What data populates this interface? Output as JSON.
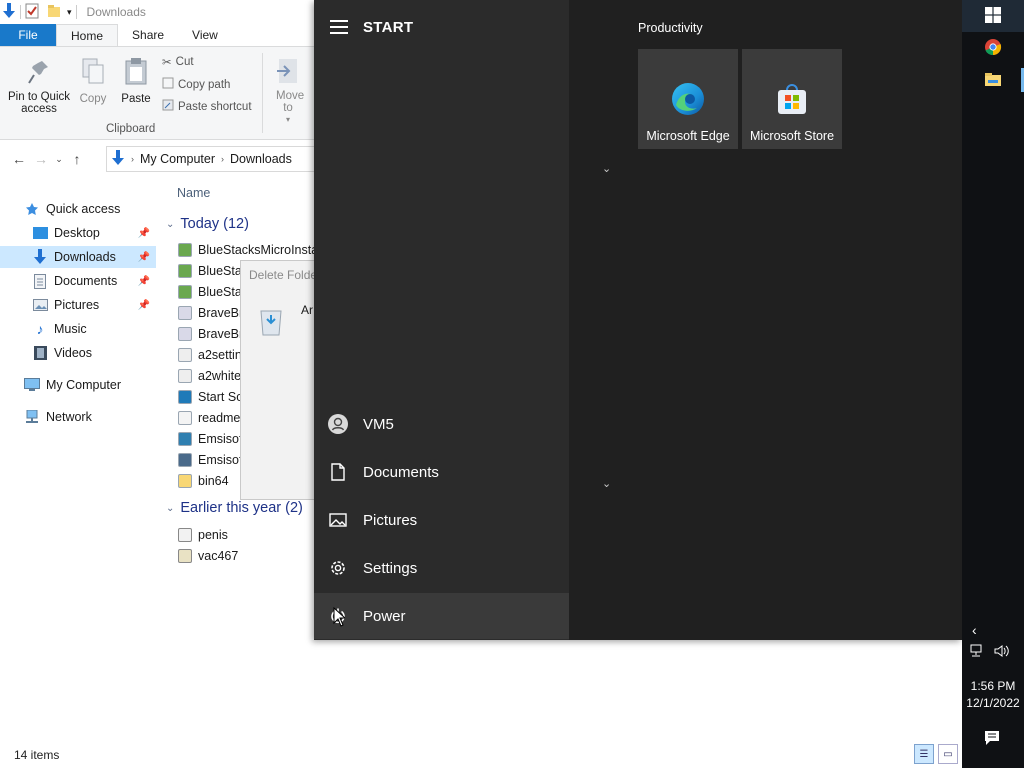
{
  "explorer": {
    "window_title": "Downloads",
    "ribbon_tabs": [
      "File",
      "Home",
      "Share",
      "View"
    ],
    "ribbon": {
      "pin_label": "Pin to Quick access",
      "copy_label": "Copy",
      "paste_label": "Paste",
      "cut_label": "Cut",
      "copy_path_label": "Copy path",
      "paste_shortcut_label": "Paste shortcut",
      "move_to_label": "Move to",
      "group_clipboard": "Clipboard"
    },
    "breadcrumb": [
      "My Computer",
      "Downloads"
    ],
    "nav": {
      "quick_access": "Quick access",
      "desktop": "Desktop",
      "downloads": "Downloads",
      "documents": "Documents",
      "pictures": "Pictures",
      "music": "Music",
      "videos": "Videos",
      "my_computer": "My Computer",
      "network": "Network"
    },
    "column_name": "Name",
    "group_today": "Today (12)",
    "group_earlier": "Earlier this year (2)",
    "files_today": [
      "BlueStacksMicroInstal",
      "BlueStac",
      "BlueStac",
      "BraveBro",
      "BraveBro",
      "a2setting",
      "a2whitel",
      "Start Sca",
      "readme",
      "Emsisoft",
      "Emsisoft",
      "bin64"
    ],
    "files_earlier": [
      "penis",
      "vac467"
    ],
    "context_header": "Delete Folde",
    "context_item": "Ar",
    "status": "14 items"
  },
  "start_menu": {
    "title": "START",
    "user": "VM5",
    "items": [
      "Documents",
      "Pictures",
      "Settings",
      "Power"
    ],
    "group_title": "Productivity",
    "tiles": [
      "Microsoft Edge",
      "Microsoft Store"
    ]
  },
  "taskbar": {
    "time": "1:56 PM",
    "date": "12/1/2022"
  },
  "colors": {
    "start_bg": "#202020",
    "start_left_bg": "#2b2b2b",
    "tile_bg": "#3b3b3b",
    "taskbar_bg": "#0f1114",
    "accent": "#1979ca",
    "nav_selected": "#cce8ff"
  }
}
